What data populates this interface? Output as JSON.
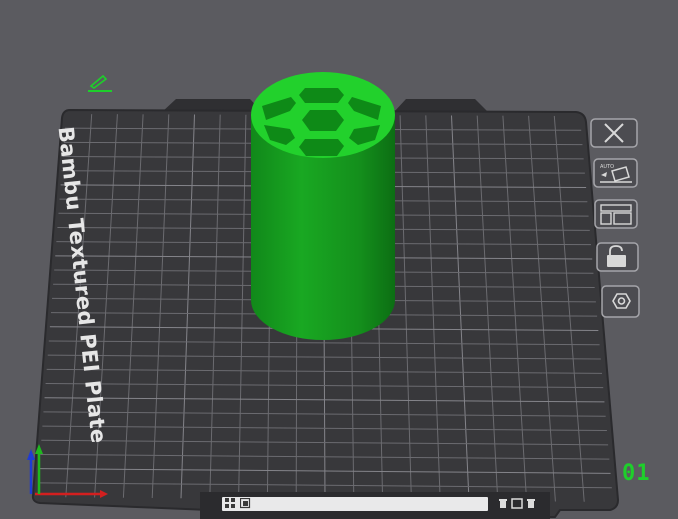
{
  "plate": {
    "name": "Bambu Textured PEI Plate",
    "number": "01"
  },
  "toolbar": {
    "tools": [
      {
        "icon": "close-icon"
      },
      {
        "icon": "auto-orient-icon"
      },
      {
        "icon": "arrange-icon"
      },
      {
        "icon": "lock-icon"
      },
      {
        "icon": "settings-hex-icon"
      }
    ]
  },
  "statusbar": {
    "text": "",
    "detail": ""
  },
  "colors": {
    "background": "#5b5b60",
    "plate": "#3a3a3d",
    "grid": "#6d6d72",
    "model": "#18a020",
    "model_top": "#22d12c",
    "accent": "#1ecf2b"
  },
  "axes": {
    "x_color": "#d31f1f",
    "y_color": "#1fb81f",
    "z_color": "#1f3bd3"
  }
}
